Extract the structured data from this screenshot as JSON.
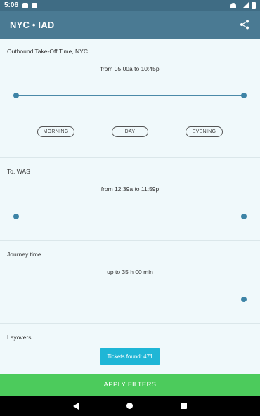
{
  "status_bar": {
    "time": "5:06"
  },
  "app_bar": {
    "title": "NYC • IAD",
    "share_icon": "share-icon"
  },
  "outbound": {
    "label": "Outbound Take-Off Time, NYC",
    "range": "from 05:00a to 10:45p",
    "slider": {
      "low_fraction": 0.0,
      "high_fraction": 1.0
    },
    "buttons": [
      "MORNING",
      "DAY",
      "EVENING"
    ]
  },
  "arrival": {
    "label": "To, WAS",
    "range": "from 12:39a to 11:59p",
    "slider": {
      "low_fraction": 0.0,
      "high_fraction": 1.0
    }
  },
  "journey": {
    "label": "Journey time",
    "range": "up to 35 h 00 min",
    "slider": {
      "fraction": 1.0
    }
  },
  "layovers": {
    "label": "Layovers"
  },
  "tickets_found": "Tickets found: 471",
  "apply_button": "APPLY FILTERS",
  "colors": {
    "app_bar": "#4a7a93",
    "accent": "#3d84a6",
    "apply": "#4ccb5c",
    "tickets": "#1fb6d6"
  }
}
